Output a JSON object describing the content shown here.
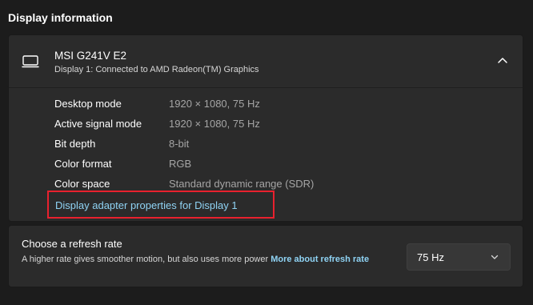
{
  "section": {
    "title": "Display information"
  },
  "display": {
    "name": "MSI G241V E2",
    "subtitle": "Display 1: Connected to AMD Radeon(TM) Graphics",
    "icon": "monitor-icon",
    "expand_icon": "chevron-up-icon",
    "info": [
      {
        "label": "Desktop mode",
        "value": "1920 × 1080, 75 Hz"
      },
      {
        "label": "Active signal mode",
        "value": "1920 × 1080, 75 Hz"
      },
      {
        "label": "Bit depth",
        "value": "8-bit"
      },
      {
        "label": "Color format",
        "value": "RGB"
      },
      {
        "label": "Color space",
        "value": "Standard dynamic range (SDR)"
      }
    ],
    "adapter_link": "Display adapter properties for Display 1"
  },
  "refresh": {
    "title": "Choose a refresh rate",
    "description": "A higher rate gives smoother motion, but also uses more power",
    "more_link": "More about refresh rate",
    "selected_rate": "75 Hz",
    "dropdown_icon": "chevron-down-icon"
  },
  "colors": {
    "background": "#1c1c1c",
    "card": "#2b2b2b",
    "link": "#8fd3f4",
    "muted_text": "#a5a5a5",
    "highlight": "#e8212e"
  }
}
